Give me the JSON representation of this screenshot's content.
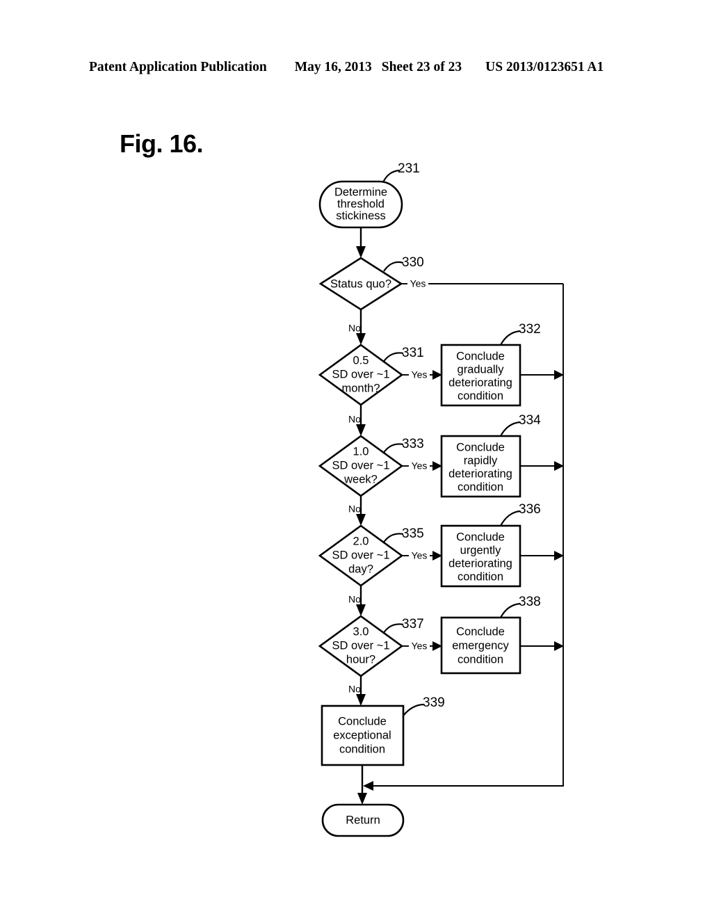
{
  "header": {
    "publication": "Patent Application Publication",
    "date": "May 16, 2013",
    "sheet": "Sheet 23 of 23",
    "patent_number": "US 2013/0123651 A1"
  },
  "figure": {
    "title": "Fig. 16."
  },
  "flowchart": {
    "labels": {
      "yes": "Yes",
      "no": "No"
    },
    "nodes": {
      "start": {
        "ref": "231",
        "lines": [
          "Determine",
          "threshold",
          "stickiness"
        ]
      },
      "status_quo": {
        "ref": "330",
        "lines": [
          "Status quo?"
        ]
      },
      "d_month": {
        "ref": "331",
        "lines": [
          "0.5",
          "SD over ~1",
          "month?"
        ]
      },
      "c_gradual": {
        "ref": "332",
        "lines": [
          "Conclude",
          "gradually",
          "deteriorating",
          "condition"
        ]
      },
      "d_week": {
        "ref": "333",
        "lines": [
          "1.0",
          "SD over ~1",
          "week?"
        ]
      },
      "c_rapid": {
        "ref": "334",
        "lines": [
          "Conclude",
          "rapidly",
          "deteriorating",
          "condition"
        ]
      },
      "d_day": {
        "ref": "335",
        "lines": [
          "2.0",
          "SD over ~1",
          "day?"
        ]
      },
      "c_urgent": {
        "ref": "336",
        "lines": [
          "Conclude",
          "urgently",
          "deteriorating",
          "condition"
        ]
      },
      "d_hour": {
        "ref": "337",
        "lines": [
          "3.0",
          "SD over ~1",
          "hour?"
        ]
      },
      "c_emergency": {
        "ref": "338",
        "lines": [
          "Conclude",
          "emergency",
          "condition"
        ]
      },
      "c_exceptional": {
        "ref": "339",
        "lines": [
          "Conclude",
          "exceptional",
          "condition"
        ]
      },
      "return": {
        "lines": [
          "Return"
        ]
      }
    }
  }
}
